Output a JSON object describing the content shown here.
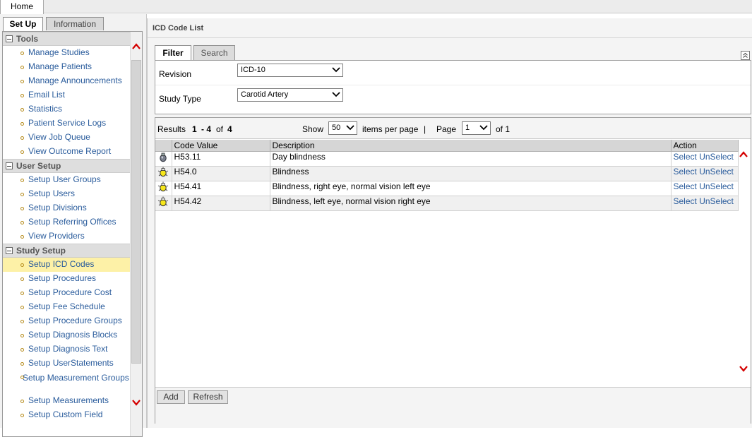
{
  "top": {
    "home_tab": "Home"
  },
  "left_tabs": {
    "setup": "Set Up",
    "information": "Information"
  },
  "menu": {
    "tools": {
      "title": "Tools",
      "items": [
        "Manage Studies",
        "Manage Patients",
        "Manage Announcements",
        "Email List",
        "Statistics",
        "Patient Service Logs",
        "View Job Queue",
        "View Outcome Report"
      ]
    },
    "user_setup": {
      "title": "User Setup",
      "items": [
        "Setup User Groups",
        "Setup Users",
        "Setup Divisions",
        "Setup Referring Offices",
        "View Providers"
      ]
    },
    "study_setup": {
      "title": "Study Setup",
      "items": [
        "Setup ICD Codes",
        "Setup Procedures",
        "Setup Procedure Cost",
        "Setup Fee Schedule",
        "Setup Procedure Groups",
        "Setup Diagnosis Blocks",
        "Setup Diagnosis Text",
        "Setup UserStatements",
        "Setup Measurement Groups",
        "Setup Measurements",
        "Setup Custom Field"
      ],
      "selected": "Setup ICD Codes"
    }
  },
  "main": {
    "title": "ICD Code List",
    "filter_tabs": {
      "filter": "Filter",
      "search": "Search"
    },
    "filters": {
      "revision_label": "Revision",
      "revision_value": "ICD-10",
      "study_type_label": "Study Type",
      "study_type_value": "Carotid Artery"
    },
    "results": {
      "label": "Results",
      "range_start": "1",
      "range_sep": "- 4",
      "of_word": "of",
      "total": "4",
      "show_label": "Show",
      "per_page": "50",
      "per_page_label": "items per page",
      "sep": "|",
      "page_label": "Page",
      "page": "1",
      "of_pages": "of 1"
    },
    "table": {
      "headers": {
        "code": "Code Value",
        "description": "Description",
        "action": "Action"
      },
      "rows": [
        {
          "code": "H53.11",
          "description": "Day blindness",
          "icon": "light-bulb-off-icon"
        },
        {
          "code": "H54.0",
          "description": "Blindness",
          "icon": "light-bulb-on-icon"
        },
        {
          "code": "H54.41",
          "description": "Blindness, right eye, normal vision left eye",
          "icon": "light-bulb-on-icon"
        },
        {
          "code": "H54.42",
          "description": "Blindness, left eye, normal vision right eye",
          "icon": "light-bulb-on-icon"
        }
      ],
      "select_label": "Select",
      "unselect_label": "UnSelect"
    },
    "buttons": {
      "add": "Add",
      "refresh": "Refresh"
    }
  }
}
